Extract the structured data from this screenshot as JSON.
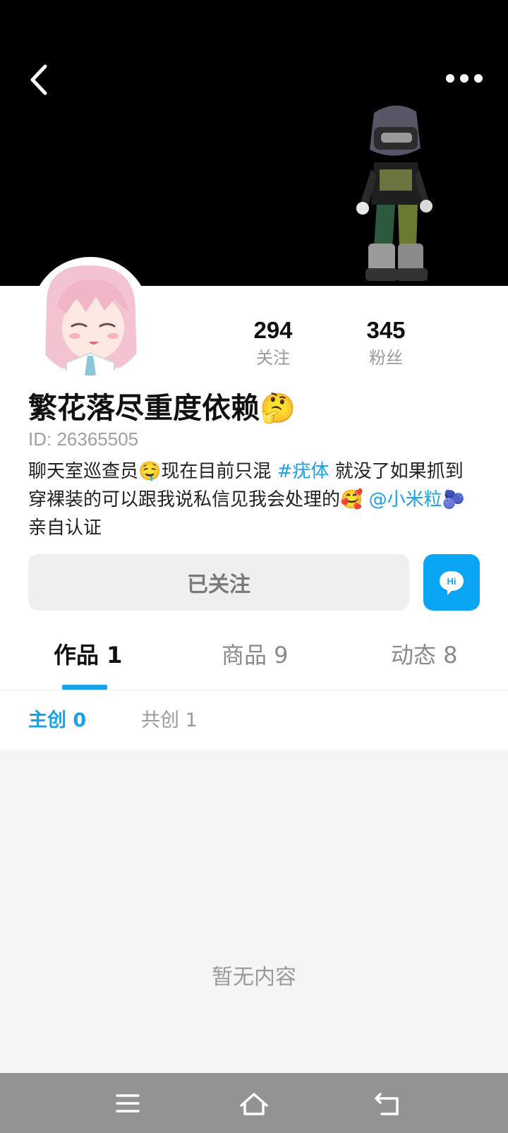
{
  "header": {
    "back_icon": "chevron-left-icon",
    "more_icon": "more-horizontal-icon"
  },
  "stats": {
    "following_count": "294",
    "following_label": "关注",
    "fans_count": "345",
    "fans_label": "粉丝"
  },
  "profile": {
    "nickname": "繁花落尽重度依赖🤔",
    "id_text": "ID: 26365505",
    "bio_part1": "聊天室巡查员🤤现在目前只混 ",
    "bio_hashtag": "#疣体",
    "bio_part2": " 就没了如果抓到穿裸装的可以跟我说私信见我会处理的🥰 ",
    "bio_mention": "@小米粒🫐",
    "bio_part3": "  亲自认证"
  },
  "actions": {
    "follow_label": "已关注",
    "chat_label": "Hi",
    "chat_color": "#0aa6f5"
  },
  "tabs": [
    {
      "label": "作品 1"
    },
    {
      "label": "商品 9"
    },
    {
      "label": "动态 8"
    }
  ],
  "subtabs": [
    {
      "label": "主创 0"
    },
    {
      "label": "共创  1"
    }
  ],
  "empty_state": "暂无内容",
  "colors": {
    "accent": "#1ba1e8",
    "banner": "#000000",
    "navbar": "#939393"
  }
}
